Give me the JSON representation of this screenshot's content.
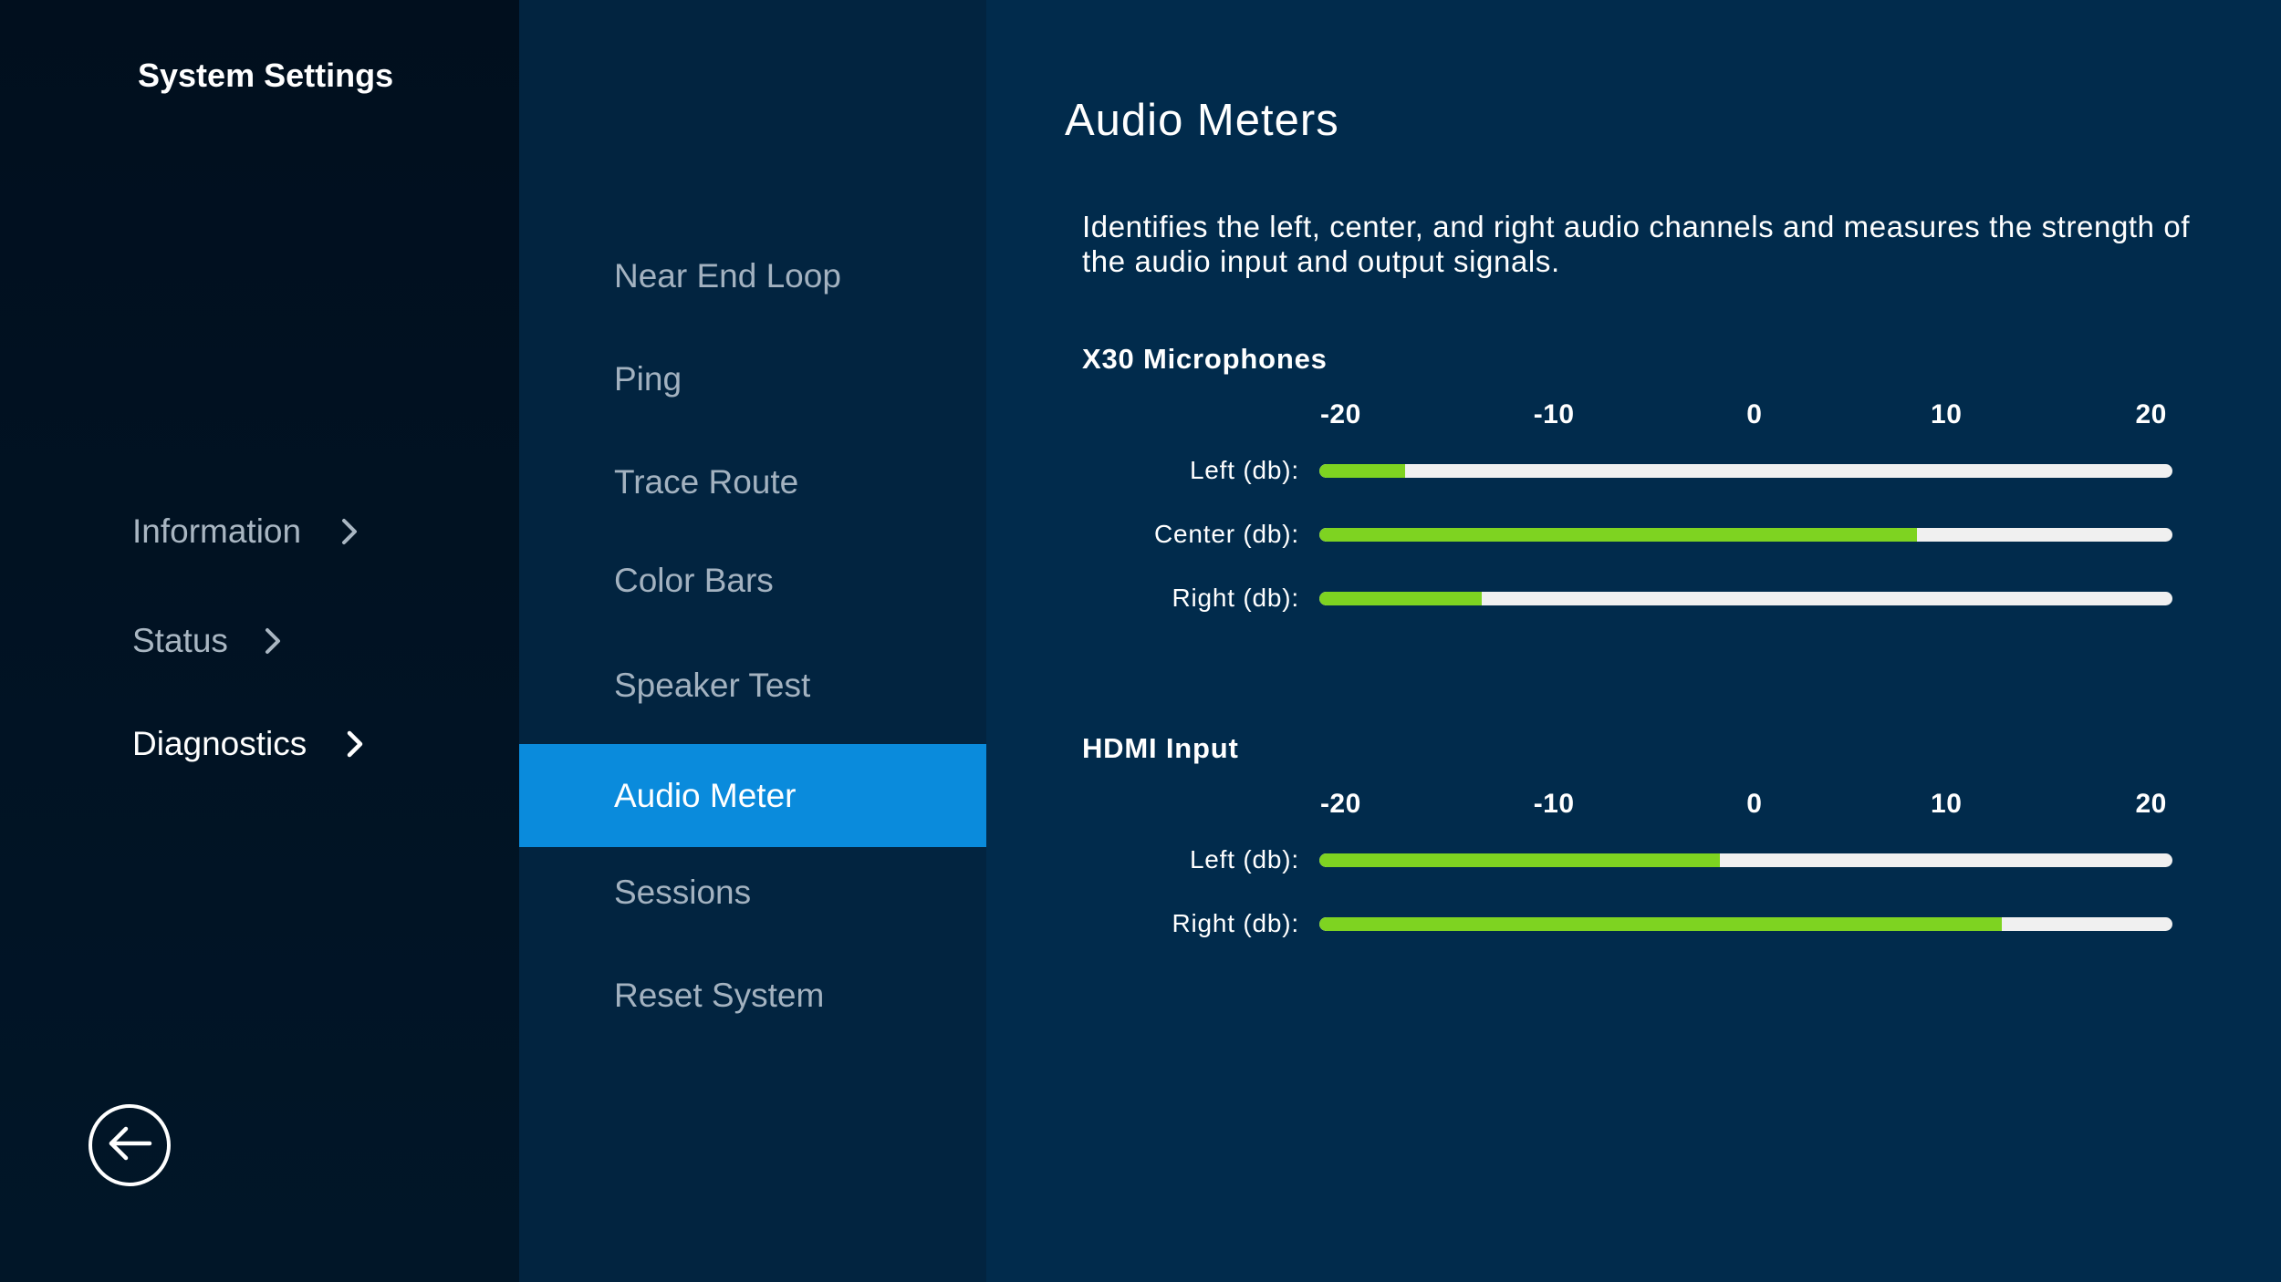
{
  "sidebar": {
    "title": "System Settings",
    "items": [
      {
        "label": "Information"
      },
      {
        "label": "Status"
      },
      {
        "label": "Diagnostics"
      }
    ],
    "back_icon": "arrow-left-circle-icon"
  },
  "submenu": {
    "items": [
      {
        "label": "Near End Loop"
      },
      {
        "label": "Ping"
      },
      {
        "label": "Trace Route"
      },
      {
        "label": "Color Bars"
      },
      {
        "label": "Speaker Test"
      },
      {
        "label": "Audio Meter"
      },
      {
        "label": "Sessions"
      },
      {
        "label": "Reset System"
      }
    ],
    "selected": "Audio Meter"
  },
  "main": {
    "title": "Audio Meters",
    "description": "Identifies the left, center, and right audio channels and measures the strength of the audio input and output signals.",
    "scale_ticks": [
      "-20",
      "-10",
      "0",
      "10",
      "20"
    ],
    "sections": [
      {
        "title": "X30 Microphones",
        "meters": [
          {
            "label": "Left (db):",
            "level_fraction": 0.1
          },
          {
            "label": "Center (db):",
            "level_fraction": 0.7
          },
          {
            "label": "Right (db):",
            "level_fraction": 0.19
          }
        ]
      },
      {
        "title": "HDMI Input",
        "meters": [
          {
            "label": "Left (db):",
            "level_fraction": 0.47
          },
          {
            "label": "Right (db):",
            "level_fraction": 0.8
          }
        ]
      }
    ]
  },
  "colors": {
    "accent_selected": "#0a8bdc",
    "meter_fill": "#7ed321",
    "meter_track": "#f0f0f0",
    "panel_bg": "#012b4c"
  }
}
